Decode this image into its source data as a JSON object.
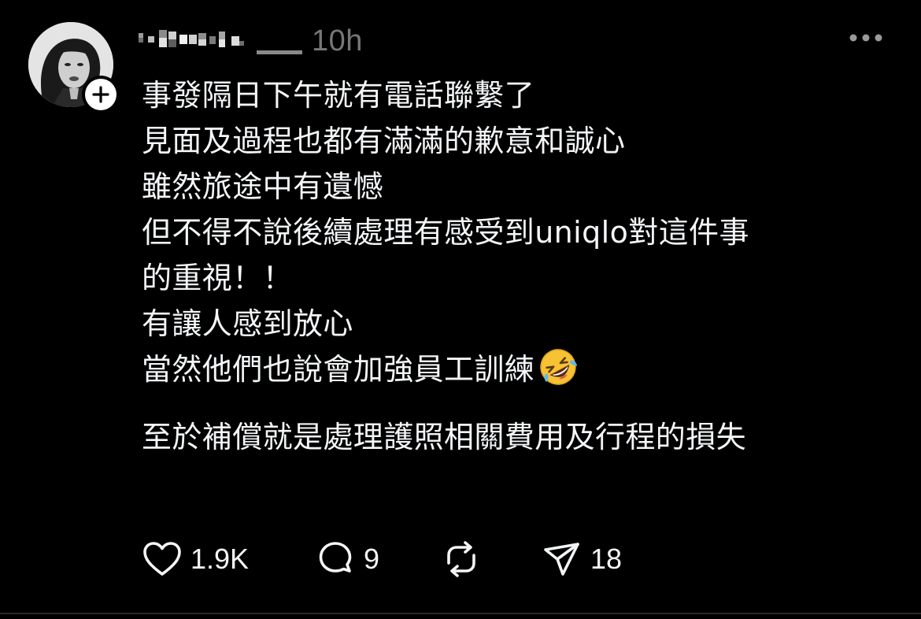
{
  "post": {
    "username_obscured": true,
    "timestamp": "10h",
    "lines": [
      "事發隔日下午就有電話聯繫了",
      "見面及過程也都有滿滿的歉意和誠心",
      "雖然旅途中有遺憾",
      "但不得不說後續處理有感受到uniqlo對這件事",
      "的重視！！",
      "有讓人感到放心",
      "當然他們也說會加強員工訓練"
    ],
    "emoji": "rolling-on-floor-laughing",
    "final_line": "至於補償就是處理護照相關費用及行程的損失"
  },
  "actions": {
    "likes": "1.9K",
    "replies": "9",
    "shares": "18"
  },
  "icons": {
    "more": "more-horizontal-icon",
    "follow": "plus-icon",
    "like": "heart-icon",
    "reply": "comment-icon",
    "repost": "repost-icon",
    "share": "send-icon"
  },
  "colors": {
    "background": "#000000",
    "text": "#f3f5f7",
    "muted": "#777777"
  }
}
